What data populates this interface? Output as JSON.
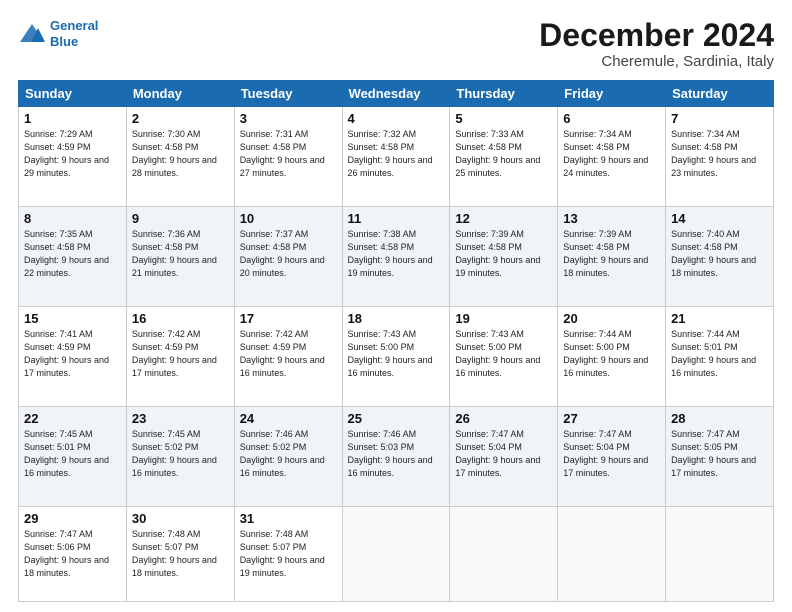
{
  "header": {
    "logo_line1": "General",
    "logo_line2": "Blue",
    "month_title": "December 2024",
    "location": "Cheremule, Sardinia, Italy"
  },
  "days_of_week": [
    "Sunday",
    "Monday",
    "Tuesday",
    "Wednesday",
    "Thursday",
    "Friday",
    "Saturday"
  ],
  "weeks": [
    [
      {
        "day": "1",
        "sunrise": "7:29 AM",
        "sunset": "4:59 PM",
        "daylight": "9 hours and 29 minutes."
      },
      {
        "day": "2",
        "sunrise": "7:30 AM",
        "sunset": "4:58 PM",
        "daylight": "9 hours and 28 minutes."
      },
      {
        "day": "3",
        "sunrise": "7:31 AM",
        "sunset": "4:58 PM",
        "daylight": "9 hours and 27 minutes."
      },
      {
        "day": "4",
        "sunrise": "7:32 AM",
        "sunset": "4:58 PM",
        "daylight": "9 hours and 26 minutes."
      },
      {
        "day": "5",
        "sunrise": "7:33 AM",
        "sunset": "4:58 PM",
        "daylight": "9 hours and 25 minutes."
      },
      {
        "day": "6",
        "sunrise": "7:34 AM",
        "sunset": "4:58 PM",
        "daylight": "9 hours and 24 minutes."
      },
      {
        "day": "7",
        "sunrise": "7:34 AM",
        "sunset": "4:58 PM",
        "daylight": "9 hours and 23 minutes."
      }
    ],
    [
      {
        "day": "8",
        "sunrise": "7:35 AM",
        "sunset": "4:58 PM",
        "daylight": "9 hours and 22 minutes."
      },
      {
        "day": "9",
        "sunrise": "7:36 AM",
        "sunset": "4:58 PM",
        "daylight": "9 hours and 21 minutes."
      },
      {
        "day": "10",
        "sunrise": "7:37 AM",
        "sunset": "4:58 PM",
        "daylight": "9 hours and 20 minutes."
      },
      {
        "day": "11",
        "sunrise": "7:38 AM",
        "sunset": "4:58 PM",
        "daylight": "9 hours and 19 minutes."
      },
      {
        "day": "12",
        "sunrise": "7:39 AM",
        "sunset": "4:58 PM",
        "daylight": "9 hours and 19 minutes."
      },
      {
        "day": "13",
        "sunrise": "7:39 AM",
        "sunset": "4:58 PM",
        "daylight": "9 hours and 18 minutes."
      },
      {
        "day": "14",
        "sunrise": "7:40 AM",
        "sunset": "4:58 PM",
        "daylight": "9 hours and 18 minutes."
      }
    ],
    [
      {
        "day": "15",
        "sunrise": "7:41 AM",
        "sunset": "4:59 PM",
        "daylight": "9 hours and 17 minutes."
      },
      {
        "day": "16",
        "sunrise": "7:42 AM",
        "sunset": "4:59 PM",
        "daylight": "9 hours and 17 minutes."
      },
      {
        "day": "17",
        "sunrise": "7:42 AM",
        "sunset": "4:59 PM",
        "daylight": "9 hours and 16 minutes."
      },
      {
        "day": "18",
        "sunrise": "7:43 AM",
        "sunset": "5:00 PM",
        "daylight": "9 hours and 16 minutes."
      },
      {
        "day": "19",
        "sunrise": "7:43 AM",
        "sunset": "5:00 PM",
        "daylight": "9 hours and 16 minutes."
      },
      {
        "day": "20",
        "sunrise": "7:44 AM",
        "sunset": "5:00 PM",
        "daylight": "9 hours and 16 minutes."
      },
      {
        "day": "21",
        "sunrise": "7:44 AM",
        "sunset": "5:01 PM",
        "daylight": "9 hours and 16 minutes."
      }
    ],
    [
      {
        "day": "22",
        "sunrise": "7:45 AM",
        "sunset": "5:01 PM",
        "daylight": "9 hours and 16 minutes."
      },
      {
        "day": "23",
        "sunrise": "7:45 AM",
        "sunset": "5:02 PM",
        "daylight": "9 hours and 16 minutes."
      },
      {
        "day": "24",
        "sunrise": "7:46 AM",
        "sunset": "5:02 PM",
        "daylight": "9 hours and 16 minutes."
      },
      {
        "day": "25",
        "sunrise": "7:46 AM",
        "sunset": "5:03 PM",
        "daylight": "9 hours and 16 minutes."
      },
      {
        "day": "26",
        "sunrise": "7:47 AM",
        "sunset": "5:04 PM",
        "daylight": "9 hours and 17 minutes."
      },
      {
        "day": "27",
        "sunrise": "7:47 AM",
        "sunset": "5:04 PM",
        "daylight": "9 hours and 17 minutes."
      },
      {
        "day": "28",
        "sunrise": "7:47 AM",
        "sunset": "5:05 PM",
        "daylight": "9 hours and 17 minutes."
      }
    ],
    [
      {
        "day": "29",
        "sunrise": "7:47 AM",
        "sunset": "5:06 PM",
        "daylight": "9 hours and 18 minutes."
      },
      {
        "day": "30",
        "sunrise": "7:48 AM",
        "sunset": "5:07 PM",
        "daylight": "9 hours and 18 minutes."
      },
      {
        "day": "31",
        "sunrise": "7:48 AM",
        "sunset": "5:07 PM",
        "daylight": "9 hours and 19 minutes."
      },
      null,
      null,
      null,
      null
    ]
  ]
}
